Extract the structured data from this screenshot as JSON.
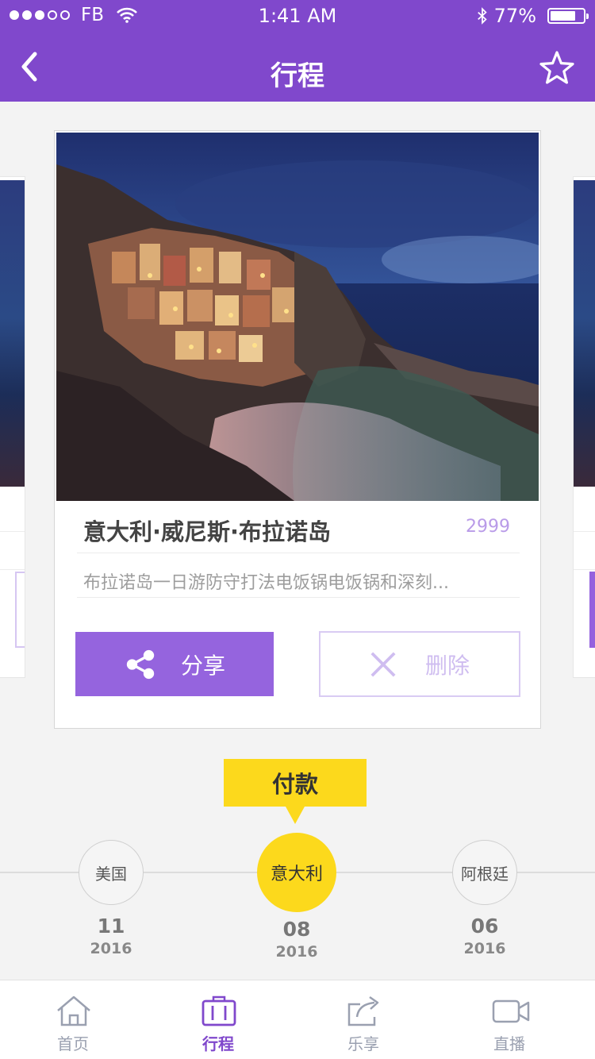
{
  "status_bar": {
    "carrier": "FB",
    "time": "1:41 AM",
    "battery_text": "77%",
    "battery_level": 0.77
  },
  "nav": {
    "title": "行程",
    "back_icon": "chevron-left-icon",
    "favorite_icon": "star-icon"
  },
  "card": {
    "title": "意大利·威尼斯·布拉诺岛",
    "price": "2999",
    "description": "布拉诺岛一日游防守打法电饭锅电饭锅和深刻...",
    "share_label": "分享",
    "delete_label": "删除"
  },
  "timeline": {
    "tooltip": "付款",
    "nodes": [
      {
        "label": "美国",
        "day": "11",
        "year": "2016"
      },
      {
        "label": "意大利",
        "day": "08",
        "year": "2016"
      },
      {
        "label": "阿根廷",
        "day": "06",
        "year": "2016"
      }
    ]
  },
  "tabbar": {
    "items": [
      {
        "label": "首页",
        "icon": "home-icon"
      },
      {
        "label": "行程",
        "icon": "luggage-icon"
      },
      {
        "label": "乐享",
        "icon": "share-icon"
      },
      {
        "label": "直播",
        "icon": "video-camera-icon"
      }
    ]
  },
  "colors": {
    "primary": "#8048cc",
    "button": "#9564de",
    "accent": "#fcd91c"
  }
}
